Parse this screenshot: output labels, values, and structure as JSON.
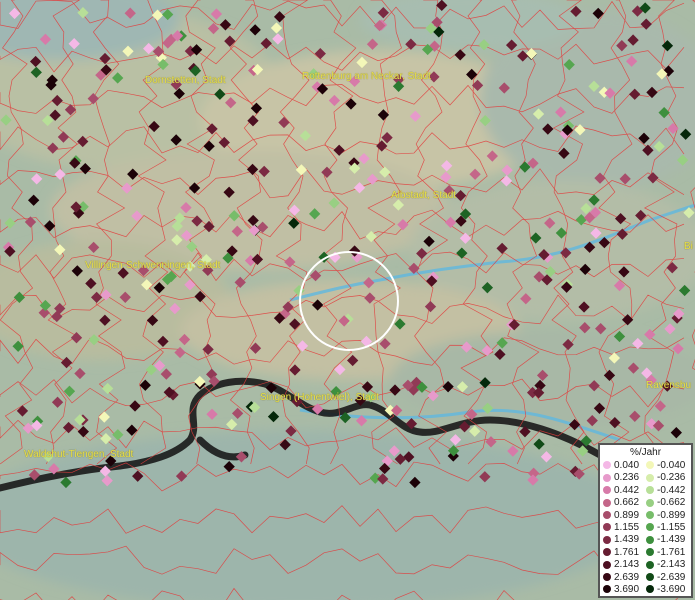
{
  "places": [
    {
      "name": "Dornstetten, Stadt",
      "cls": "place-dornstetten"
    },
    {
      "name": "Rottenburg am Neckar, Stadt",
      "cls": "place-rottenburg"
    },
    {
      "name": "Albstadt, Stadt",
      "cls": "place-albstadt"
    },
    {
      "name": "Villingen-Schwenningen, Stadt",
      "cls": "place-villingen"
    },
    {
      "name": "Singen (Hohentwiel), Stadt",
      "cls": "place-singen"
    },
    {
      "name": "Waldshut-Tiengen, Stadt",
      "cls": "place-waldshut"
    },
    {
      "name": "Ravensbu",
      "cls": "place-ravensburg"
    },
    {
      "name": "Bi",
      "cls": "place-biberach"
    }
  ],
  "legend": {
    "title": "%/Jahr",
    "positive": [
      {
        "label": "0.040",
        "color": "#f4b8e6"
      },
      {
        "label": "0.236",
        "color": "#e79acb"
      },
      {
        "label": "0.442",
        "color": "#d77aa9"
      },
      {
        "label": "0.662",
        "color": "#c46689"
      },
      {
        "label": "0.899",
        "color": "#a84e6c"
      },
      {
        "label": "1.155",
        "color": "#913a56"
      },
      {
        "label": "1.439",
        "color": "#7c2a43"
      },
      {
        "label": "1.761",
        "color": "#651c31"
      },
      {
        "label": "2.143",
        "color": "#4e1022"
      },
      {
        "label": "2.639",
        "color": "#370814"
      },
      {
        "label": "3.690",
        "color": "#1c0208"
      }
    ],
    "negative": [
      {
        "label": "-0.040",
        "color": "#f3f7b8"
      },
      {
        "label": "-0.236",
        "color": "#d6edab"
      },
      {
        "label": "-0.442",
        "color": "#b7df98"
      },
      {
        "label": "-0.662",
        "color": "#98cf83"
      },
      {
        "label": "-0.899",
        "color": "#77bd6a"
      },
      {
        "label": "-1.155",
        "color": "#56a650"
      },
      {
        "label": "-1.439",
        "color": "#3e903e"
      },
      {
        "label": "-1.761",
        "color": "#2b7a30"
      },
      {
        "label": "-2.143",
        "color": "#1d6324"
      },
      {
        "label": "-2.639",
        "color": "#114a17"
      },
      {
        "label": "-3.690",
        "color": "#05280a"
      }
    ]
  }
}
